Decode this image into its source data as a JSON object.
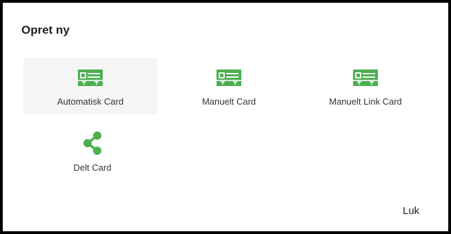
{
  "dialog": {
    "title": "Opret ny",
    "close_label": "Luk"
  },
  "options": [
    {
      "label": "Automatisk Card",
      "icon": "card-icon"
    },
    {
      "label": "Manuelt Card",
      "icon": "card-icon"
    },
    {
      "label": "Manuelt Link Card",
      "icon": "card-icon"
    },
    {
      "label": "Delt Card",
      "icon": "share-icon"
    }
  ],
  "colors": {
    "icon_green": "#4caf50",
    "highlight_bg": "#f5f5f5",
    "border": "#000000"
  }
}
